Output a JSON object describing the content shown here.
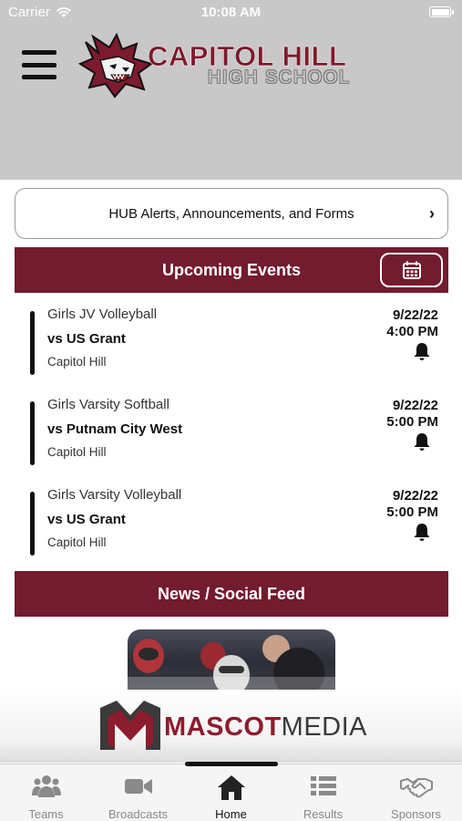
{
  "status_bar": {
    "carrier": "Carrier",
    "time": "10:08 AM"
  },
  "header": {
    "school_name": "CAPITOL HILL",
    "school_subtitle": "HIGH SCHOOL",
    "brand_color": "#7d1a2e",
    "background": "#c8c8c8"
  },
  "alerts_button": {
    "label": "HUB Alerts, Announcements, and Forms",
    "chevron": "›"
  },
  "upcoming_events": {
    "title": "Upcoming Events",
    "bar_color": "#731b2f",
    "events": [
      {
        "team": "Girls JV Volleyball",
        "opponent": "vs US Grant",
        "location": "Capitol Hill",
        "date": "9/22/22",
        "time": "4:00 PM"
      },
      {
        "team": "Girls Varsity Softball",
        "opponent": "vs Putnam City West",
        "location": "Capitol Hill",
        "date": "9/22/22",
        "time": "5:00 PM"
      },
      {
        "team": "Girls Varsity Volleyball",
        "opponent": "vs US Grant",
        "location": "Capitol Hill",
        "date": "9/22/22",
        "time": "5:00 PM"
      }
    ]
  },
  "news": {
    "title": "News / Social Feed"
  },
  "sponsor": {
    "name_part1": "MASCOT",
    "name_part2": "MEDIA",
    "color": "#8c1c2e"
  },
  "tab_bar": {
    "active_tab": "Home",
    "tabs": [
      {
        "label": "Teams",
        "icon": "teams-icon"
      },
      {
        "label": "Broadcasts",
        "icon": "video-camera-icon"
      },
      {
        "label": "Home",
        "icon": "home-icon"
      },
      {
        "label": "Results",
        "icon": "list-icon"
      },
      {
        "label": "Sponsors",
        "icon": "handshake-icon"
      }
    ]
  }
}
